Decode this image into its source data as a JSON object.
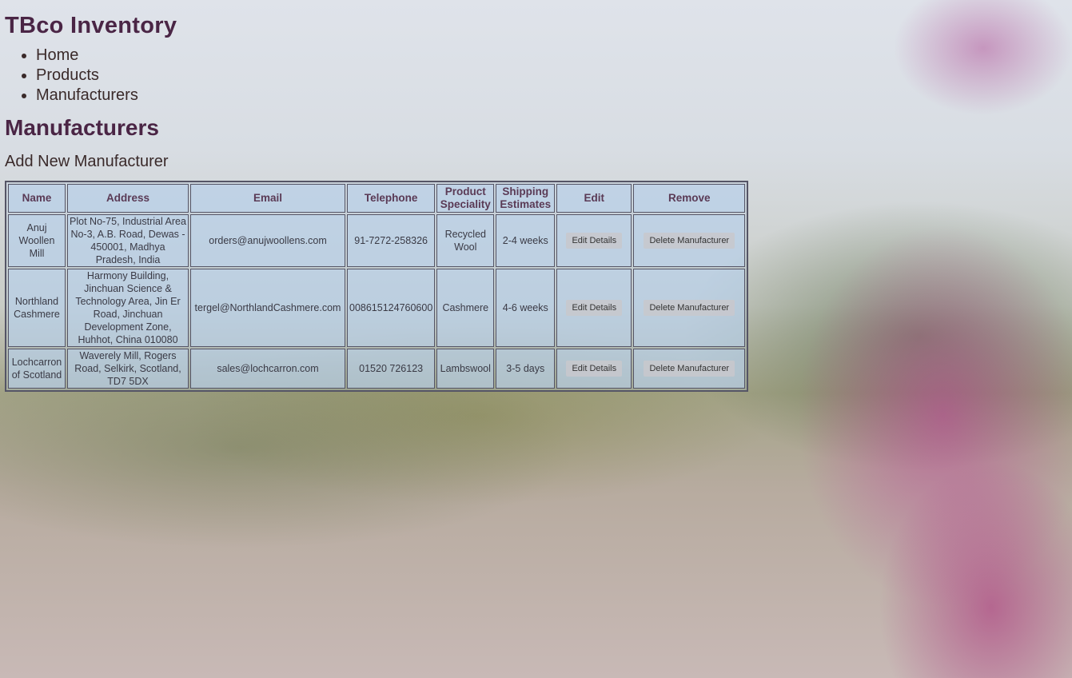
{
  "site_title": "TBco Inventory",
  "nav": [
    {
      "label": "Home"
    },
    {
      "label": "Products"
    },
    {
      "label": "Manufacturers"
    }
  ],
  "page_title": "Manufacturers",
  "add_link": "Add New Manufacturer",
  "table": {
    "headers": [
      "Name",
      "Address",
      "Email",
      "Telephone",
      "Product Speciality",
      "Shipping Estimates",
      "Edit",
      "Remove"
    ],
    "rows": [
      {
        "name": "Anuj Woollen Mill",
        "address": "Plot No-75, Industrial Area No-3, A.B. Road, Dewas - 450001, Madhya Pradesh, India",
        "email": "orders@anujwoollens.com",
        "telephone": "91-7272-258326",
        "speciality": "Recycled Wool",
        "shipping": "2-4 weeks",
        "edit_label": "Edit Details",
        "remove_label": "Delete Manufacturer"
      },
      {
        "name": "Northland Cashmere",
        "address": "Harmony Building, Jinchuan Science & Technology Area, Jin Er Road, Jinchuan Development Zone, Huhhot, China 010080",
        "email": "tergel@NorthlandCashmere.com",
        "telephone": "008615124760600",
        "speciality": "Cashmere",
        "shipping": "4-6 weeks",
        "edit_label": "Edit Details",
        "remove_label": "Delete Manufacturer"
      },
      {
        "name": "Lochcarron of Scotland",
        "address": "Waverely Mill, Rogers Road, Selkirk, Scotland, TD7 5DX",
        "email": "sales@lochcarron.com",
        "telephone": "01520 726123",
        "speciality": "Lambswool",
        "shipping": "3-5 days",
        "edit_label": "Edit Details",
        "remove_label": "Delete Manufacturer"
      }
    ]
  },
  "colors": {
    "heading": "#4a2545",
    "text": "#3a2a2a"
  }
}
